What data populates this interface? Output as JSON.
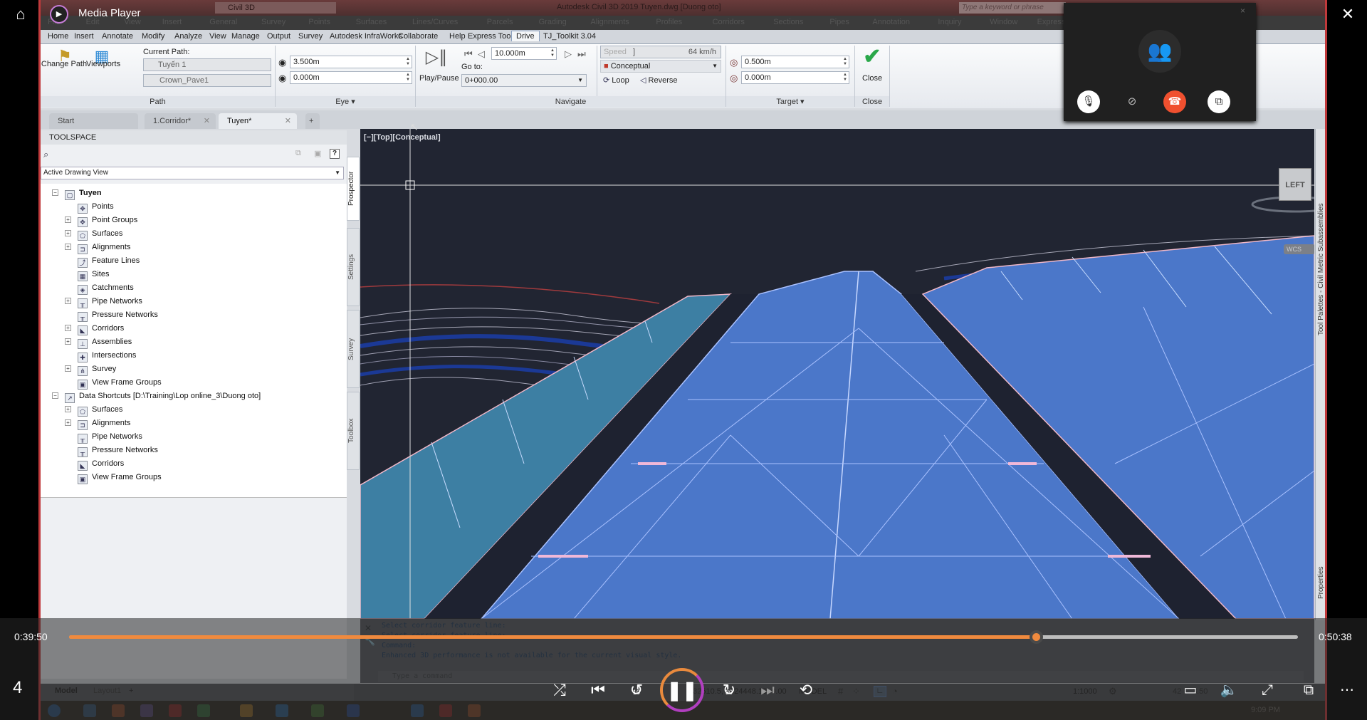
{
  "media_player": {
    "title": "Media Player",
    "home_icon": "home-icon",
    "close_icon": "close-icon",
    "current_time": "0:39:50",
    "total_time": "0:50:38",
    "progress_fraction": 0.787,
    "track_number": "4",
    "controls": [
      {
        "name": "shuffle-off",
        "glyph": "⤮"
      },
      {
        "name": "previous",
        "glyph": "⏮"
      },
      {
        "name": "rewind-10",
        "glyph": "↺"
      },
      {
        "name": "forward-30",
        "glyph": "↻"
      },
      {
        "name": "next",
        "glyph": "⏭"
      },
      {
        "name": "repeat-off",
        "glyph": "⟲"
      }
    ],
    "rewind_label": "10",
    "forward_label": "30",
    "play_pause_glyph": "❚❚",
    "right_controls": [
      {
        "name": "subtitles",
        "glyph": "▭"
      },
      {
        "name": "volume",
        "glyph": "🔈"
      },
      {
        "name": "fullscreen",
        "glyph": "⤢"
      },
      {
        "name": "mini-view",
        "glyph": "⧉"
      },
      {
        "name": "more",
        "glyph": "⋯"
      }
    ],
    "accent": "#f08a3e"
  },
  "call_window": {
    "close_glyph": "×",
    "avatar_glyph": "👥",
    "buttons": [
      {
        "name": "microphone",
        "glyph": "🎙",
        "bg": "#ffffff",
        "color": "#333"
      },
      {
        "name": "camera-off",
        "glyph": "⊘",
        "bg": "#202020",
        "color": "#bbb"
      },
      {
        "name": "hang-up",
        "glyph": "☎",
        "bg": "#f0502f",
        "color": "#fff"
      },
      {
        "name": "pop-out",
        "glyph": "⧉",
        "bg": "#ffffff",
        "color": "#333"
      }
    ]
  },
  "civil3d": {
    "workspace": "Civil 3D",
    "title": "Autodesk Civil 3D 2019    Tuyen.dwg [Duong oto]",
    "search_placeholder": "Type a keyword or phrase",
    "menubar": [
      "File",
      "Edit",
      "View",
      "Insert",
      "General",
      "Survey",
      "Points",
      "Surfaces",
      "Lines/Curves",
      "Parcels",
      "Grading",
      "Alignments",
      "Profiles",
      "Corridors",
      "Sections",
      "Pipes",
      "Annotation",
      "Inquiry",
      "Window",
      "Express"
    ],
    "ribbon_tabs": [
      "Home",
      "Insert",
      "Annotate",
      "Modify",
      "Analyze",
      "View",
      "Manage",
      "Output",
      "Survey",
      "Autodesk InfraWorks",
      "Collaborate",
      "Help",
      "Express Tools",
      "Drive",
      "TJ_Toolkit 3.04"
    ],
    "active_ribbon_tab": "Drive",
    "ribbon": {
      "path": {
        "label": "Path",
        "change_path": "Change Path",
        "viewports": "Viewports",
        "current_path_label": "Current Path:",
        "current_path": "Tuyến 1",
        "feature_line": "Crown_Pave1"
      },
      "eye": {
        "label": "Eye",
        "height": "3.500m",
        "offset": "0.000m"
      },
      "navigate": {
        "label": "Navigate",
        "play_pause": "Play/Pause",
        "step": "10.000m",
        "goto_label": "Go to:",
        "goto_value": "0+000.00",
        "speed_label": "Speed",
        "speed_value": "64 km/h",
        "visual_style": "Conceptual",
        "loop": "Loop",
        "reverse": "Reverse"
      },
      "target": {
        "label": "Target",
        "height": "0.500m",
        "offset": "0.000m"
      },
      "close": {
        "label": "Close",
        "button": "Close"
      }
    },
    "doc_tabs": [
      {
        "label": "Start",
        "closable": false
      },
      {
        "label": "1.Corridor*",
        "closable": true
      },
      {
        "label": "Tuyen*",
        "closable": true,
        "active": true
      }
    ],
    "new_tab_glyph": "+",
    "toolspace": {
      "title": "TOOLSPACE",
      "view_select": "Active Drawing View",
      "vertical_tabs": [
        "Prospector",
        "Settings",
        "Survey",
        "Toolbox"
      ],
      "tree": [
        {
          "label": "Tuyen",
          "level": 0,
          "expander": "−",
          "bold": true,
          "icon": "▢"
        },
        {
          "label": "Points",
          "level": 1,
          "expander": "",
          "icon": "✥"
        },
        {
          "label": "Point Groups",
          "level": 1,
          "expander": "+",
          "icon": "✥"
        },
        {
          "label": "Surfaces",
          "level": 1,
          "expander": "+",
          "icon": "⬠"
        },
        {
          "label": "Alignments",
          "level": 1,
          "expander": "+",
          "icon": "⊐"
        },
        {
          "label": "Feature Lines",
          "level": 1,
          "expander": "",
          "icon": "⤴"
        },
        {
          "label": "Sites",
          "level": 1,
          "expander": "",
          "icon": "▦"
        },
        {
          "label": "Catchments",
          "level": 1,
          "expander": "",
          "icon": "◈"
        },
        {
          "label": "Pipe Networks",
          "level": 1,
          "expander": "+",
          "icon": "╥"
        },
        {
          "label": "Pressure Networks",
          "level": 1,
          "expander": "",
          "icon": "╥"
        },
        {
          "label": "Corridors",
          "level": 1,
          "expander": "+",
          "icon": "◣"
        },
        {
          "label": "Assemblies",
          "level": 1,
          "expander": "+",
          "icon": "⊥"
        },
        {
          "label": "Intersections",
          "level": 1,
          "expander": "",
          "icon": "✚"
        },
        {
          "label": "Survey",
          "level": 1,
          "expander": "+",
          "icon": "⋔"
        },
        {
          "label": "View Frame Groups",
          "level": 1,
          "expander": "",
          "icon": "▣"
        },
        {
          "label": "Data Shortcuts [D:\\Training\\Lop online_3\\Duong oto]",
          "level": 0,
          "expander": "−",
          "icon": "↗"
        },
        {
          "label": "Surfaces",
          "level": 1,
          "expander": "+",
          "icon": "⬠"
        },
        {
          "label": "Alignments",
          "level": 1,
          "expander": "+",
          "icon": "⊐"
        },
        {
          "label": "Pipe Networks",
          "level": 1,
          "expander": "",
          "icon": "╥"
        },
        {
          "label": "Pressure Networks",
          "level": 1,
          "expander": "",
          "icon": "╥"
        },
        {
          "label": "Corridors",
          "level": 1,
          "expander": "",
          "icon": "◣"
        },
        {
          "label": "View Frame Groups",
          "level": 1,
          "expander": "",
          "icon": "▣"
        }
      ]
    },
    "viewport": {
      "label": "[−][Top][Conceptual]",
      "viewcube_face": "LEFT",
      "wcs": "WCS"
    },
    "right_palettes": [
      "Tool Palettes - Civil Metric Subassemblies",
      "Properties"
    ],
    "command_history": [
      "Select corridor feature line:",
      "Select corridor feature line:",
      "Command:",
      "Enhanced 3D performance is not available for the current visual style."
    ],
    "command_placeholder": "Type a command",
    "layout_tabs": [
      "Model",
      "Layout1"
    ],
    "status": {
      "coords": "732610.5, 1024448.10, 0.00",
      "space": "MODEL",
      "scale": "1:1000",
      "annot_val_1": "42",
      "annot_val_2": "3.50"
    },
    "clock": "9:09 PM"
  }
}
